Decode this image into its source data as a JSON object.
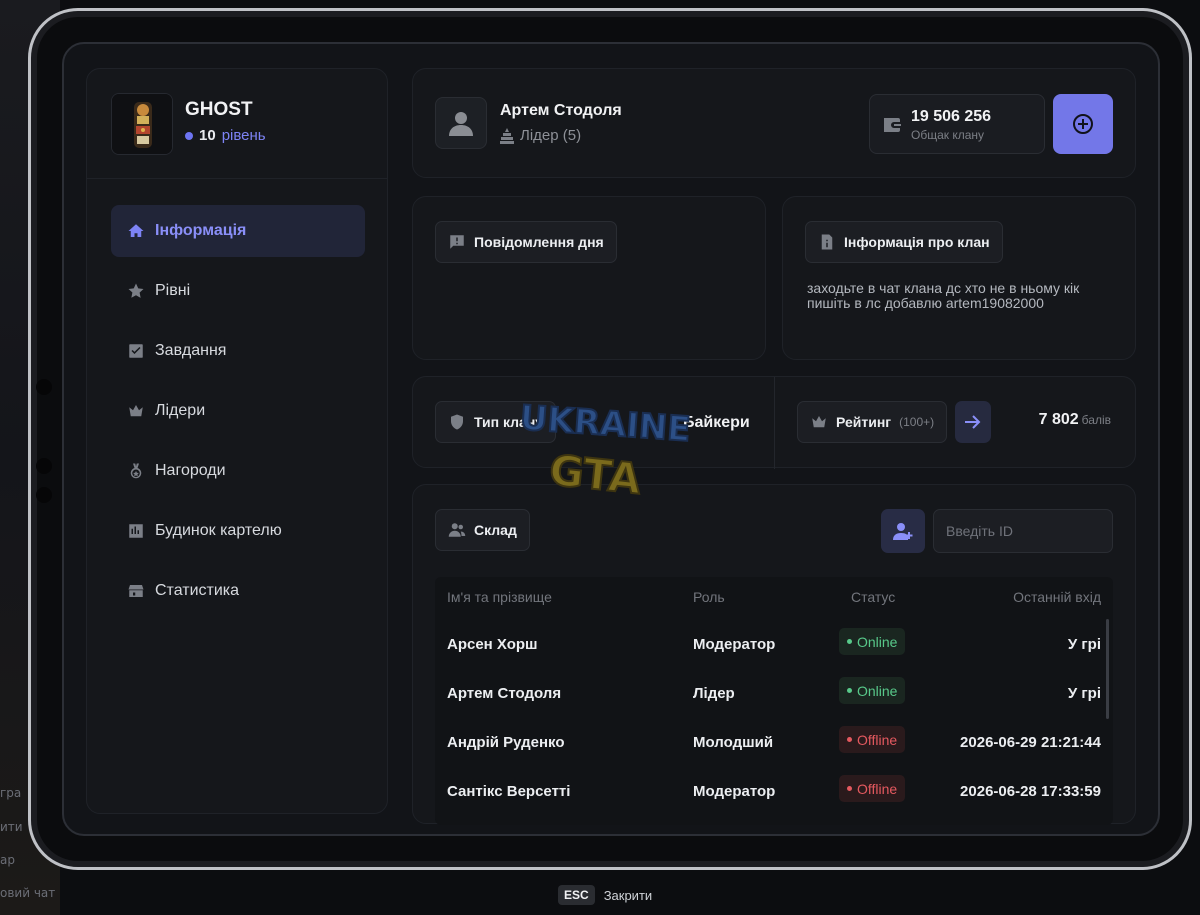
{
  "background": {
    "left_texts": [
      "гра",
      "ити",
      "ар",
      "овий чат"
    ]
  },
  "clan": {
    "name": "GHOST",
    "level_number": "10",
    "level_word": "рівень"
  },
  "sidebar": {
    "items": [
      {
        "label": "Інформація",
        "icon": "home-icon",
        "active": true
      },
      {
        "label": "Рівні",
        "icon": "star-icon",
        "active": false
      },
      {
        "label": "Завдання",
        "icon": "checkbox-icon",
        "active": false
      },
      {
        "label": "Лідери",
        "icon": "crown-icon",
        "active": false
      },
      {
        "label": "Нагороди",
        "icon": "medal-icon",
        "active": false
      },
      {
        "label": "Будинок картелю",
        "icon": "chart-icon",
        "active": false
      },
      {
        "label": "Статистика",
        "icon": "store-icon",
        "active": false
      }
    ]
  },
  "header": {
    "user_name": "Артем Стодоля",
    "user_role": "Лідер (5)",
    "bank_amount": "19 506 256",
    "bank_label": "Общак клану"
  },
  "message_of_day": {
    "title": "Повідомлення дня"
  },
  "clan_info": {
    "title": "Інформація про клан",
    "text": "заходьте в чат клана дс хто не в ньому кік пишіть в лс добавлю artem19082000"
  },
  "clan_type": {
    "label": "Тип клану",
    "value": "Байкери"
  },
  "rating": {
    "label": "Рейтинг",
    "sub": "(100+)",
    "value": "7 802",
    "unit": "балів"
  },
  "members": {
    "title": "Склад",
    "id_placeholder": "Введіть ID",
    "columns": [
      "Ім'я та прізвище",
      "Роль",
      "Статус",
      "Останній вхід"
    ],
    "rows": [
      {
        "name": "Арсен Хорш",
        "role": "Модератор",
        "status": "Online",
        "last": "У грі"
      },
      {
        "name": "Артем Стодоля",
        "role": "Лідер",
        "status": "Online",
        "last": "У грі"
      },
      {
        "name": "Андрій Руденко",
        "role": "Молодший",
        "status": "Offline",
        "last": "2026-06-29 21:21:44"
      },
      {
        "name": "Сантікс Версетті",
        "role": "Модератор",
        "status": "Offline",
        "last": "2026-06-28 17:33:59"
      }
    ]
  },
  "watermark": {
    "line1": "UKRAINE",
    "line2": "GTA"
  },
  "footer": {
    "esc_key": "ESC",
    "esc_label": "Закрити"
  },
  "colors": {
    "accent": "#7377e8",
    "online": "#58c98a",
    "offline": "#e4595f"
  }
}
